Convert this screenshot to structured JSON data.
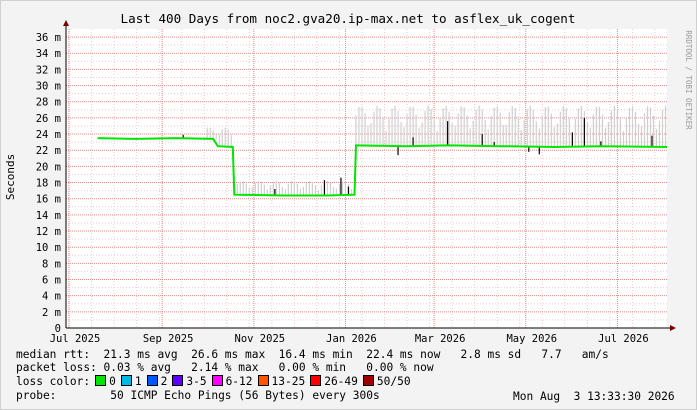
{
  "chart_data": {
    "type": "line",
    "title": "Last 400 Days from noc2.gva20.ip-max.net to asflex_uk_cogent",
    "ylabel": "Seconds",
    "watermark": "RRDTOOL / TOBI OETIKER",
    "ylim": [
      0,
      37
    ],
    "yticks": [
      {
        "v": 0,
        "label": "0"
      },
      {
        "v": 2,
        "label": "2 m"
      },
      {
        "v": 4,
        "label": "4 m"
      },
      {
        "v": 6,
        "label": "6 m"
      },
      {
        "v": 8,
        "label": "8 m"
      },
      {
        "v": 10,
        "label": "10 m"
      },
      {
        "v": 12,
        "label": "12 m"
      },
      {
        "v": 14,
        "label": "14 m"
      },
      {
        "v": 16,
        "label": "16 m"
      },
      {
        "v": 18,
        "label": "18 m"
      },
      {
        "v": 20,
        "label": "20 m"
      },
      {
        "v": 22,
        "label": "22 m"
      },
      {
        "v": 24,
        "label": "24 m"
      },
      {
        "v": 26,
        "label": "26 m"
      },
      {
        "v": 28,
        "label": "28 m"
      },
      {
        "v": 30,
        "label": "30 m"
      },
      {
        "v": 32,
        "label": "32 m"
      },
      {
        "v": 34,
        "label": "34 m"
      },
      {
        "v": 36,
        "label": "36 m"
      }
    ],
    "xlim": [
      "2025-06-29",
      "2026-08-03"
    ],
    "xticks": [
      {
        "date": "2025-07-01",
        "label": "Jul 2025"
      },
      {
        "date": "2025-09-01",
        "label": "Sep 2025"
      },
      {
        "date": "2025-11-01",
        "label": "Nov 2025"
      },
      {
        "date": "2026-01-01",
        "label": "Jan 2026"
      },
      {
        "date": "2026-03-01",
        "label": "Mar 2026"
      },
      {
        "date": "2026-05-01",
        "label": "May 2026"
      },
      {
        "date": "2026-07-01",
        "label": "Jul 2026"
      }
    ],
    "series": [
      {
        "name": "median rtt",
        "color": "#00e600",
        "points": [
          [
            "2025-07-20",
            23.5
          ],
          [
            "2025-08-15",
            23.4
          ],
          [
            "2025-09-10",
            23.5
          ],
          [
            "2025-10-05",
            23.4
          ],
          [
            "2025-10-08",
            22.5
          ],
          [
            "2025-10-18",
            22.4
          ],
          [
            "2025-10-19",
            16.5
          ],
          [
            "2025-11-20",
            16.4
          ],
          [
            "2025-12-20",
            16.4
          ],
          [
            "2026-01-07",
            16.5
          ],
          [
            "2026-01-08",
            22.6
          ],
          [
            "2026-02-10",
            22.5
          ],
          [
            "2026-03-10",
            22.6
          ],
          [
            "2026-04-15",
            22.5
          ],
          [
            "2026-05-20",
            22.4
          ],
          [
            "2026-06-20",
            22.5
          ],
          [
            "2026-08-03",
            22.4
          ]
        ]
      }
    ],
    "spikes": [
      [
        "2025-09-15",
        23.9
      ],
      [
        "2025-11-15",
        17.2
      ],
      [
        "2025-12-18",
        18.3
      ],
      [
        "2025-12-29",
        18.6
      ],
      [
        "2026-01-03",
        17.5
      ],
      [
        "2026-02-05",
        21.4
      ],
      [
        "2026-02-15",
        23.6
      ],
      [
        "2026-03-10",
        25.6
      ],
      [
        "2026-04-02",
        24.0
      ],
      [
        "2026-04-10",
        23.0
      ],
      [
        "2026-05-03",
        21.8
      ],
      [
        "2026-05-10",
        21.5
      ],
      [
        "2026-06-01",
        24.2
      ],
      [
        "2026-06-09",
        26.0
      ],
      [
        "2026-06-20",
        23.1
      ],
      [
        "2026-07-24",
        23.8
      ]
    ],
    "jitter_band": {
      "color": "#cfcfcf",
      "segments": [
        {
          "from": "2025-10-01",
          "to": "2025-10-18",
          "high": 24.8
        },
        {
          "from": "2025-10-19",
          "to": "2026-01-07",
          "high": 18.2
        },
        {
          "from": "2026-01-08",
          "to": "2026-08-03",
          "high": 27.5
        }
      ]
    },
    "grid": true,
    "legend_position": "bottom"
  },
  "legend": {
    "median_rtt": "median rtt:  21.3 ms avg  26.6 ms max  16.4 ms min  22.4 ms now   2.8 ms sd   7.7   am/s",
    "packet_loss": "packet loss: 0.03 % avg   2.14 % max   0.00 % min   0.00 % now",
    "loss_color_label": "loss color:",
    "loss_colors": [
      {
        "label": "0",
        "color": "#00e600"
      },
      {
        "label": "1",
        "color": "#00b8e6"
      },
      {
        "label": "2",
        "color": "#0059ff"
      },
      {
        "label": "3-5",
        "color": "#5e00ff"
      },
      {
        "label": "6-12",
        "color": "#ff00ff"
      },
      {
        "label": "13-25",
        "color": "#ff5500"
      },
      {
        "label": "26-49",
        "color": "#ff0000"
      },
      {
        "label": "50/50",
        "color": "#a10000"
      }
    ],
    "probe": "probe:        50 ICMP Echo Pings (56 Bytes) every 300s",
    "timestamp": "Mon Aug  3 13:33:30 2026"
  }
}
